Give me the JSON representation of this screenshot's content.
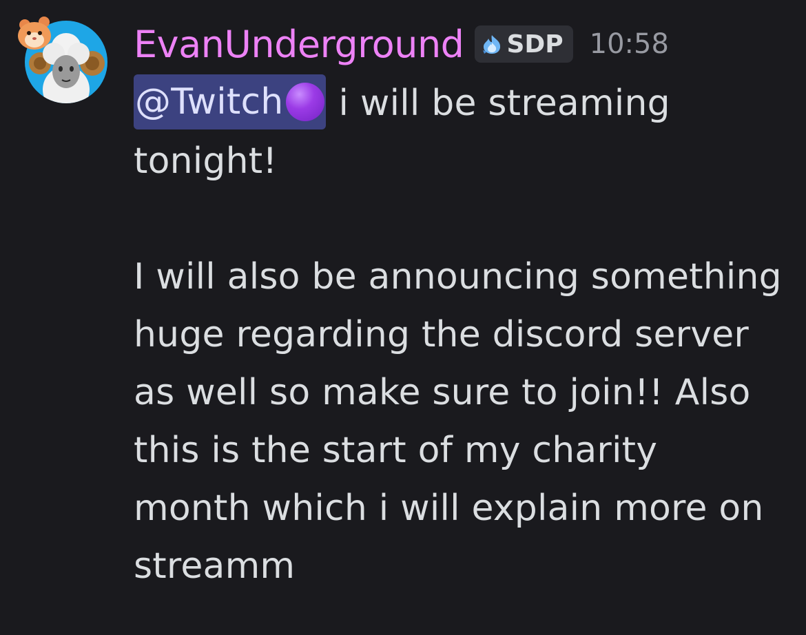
{
  "message": {
    "author": {
      "username": "EvanUnderground",
      "username_color": "#ed82f6",
      "avatar_icon": "ram-avatar-icon",
      "avatar_decoration_icon": "hamster-decoration-icon"
    },
    "server_tag": {
      "icon": "blue-flame-icon",
      "label": "SDP"
    },
    "timestamp": "10:58",
    "mention": {
      "label": "@Twitch",
      "icon": "purple-circle-emoji",
      "color": "#3c4280"
    },
    "body": {
      "line1_rest": "i will be streaming",
      "line2": "tonight!",
      "line3": "I will also be announcing something",
      "line4": "huge regarding the discord server",
      "line5": "as well so make sure to join!! Also",
      "line6": "this is the start of my charity",
      "line7": "month which i will explain more on",
      "line8": "streamm"
    }
  }
}
